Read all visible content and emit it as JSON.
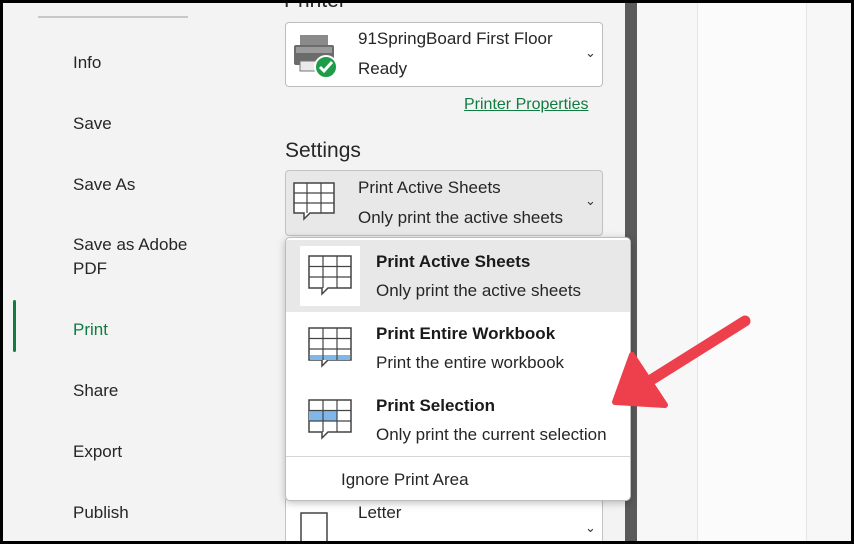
{
  "nav": {
    "items": [
      {
        "label": "Info"
      },
      {
        "label": "Save"
      },
      {
        "label": "Save As"
      },
      {
        "label": "Save as Adobe PDF"
      },
      {
        "label": "Print"
      },
      {
        "label": "Share"
      },
      {
        "label": "Export"
      },
      {
        "label": "Publish"
      }
    ],
    "active": "Print"
  },
  "printer": {
    "heading": "Printer",
    "name": "91SpringBoard First Floor",
    "status": "Ready",
    "properties_link": "Printer Properties"
  },
  "settings": {
    "heading": "Settings",
    "selected_title": "Print Active Sheets",
    "selected_sub": "Only print the active sheets",
    "paper": "Letter"
  },
  "menu": {
    "items": [
      {
        "title": "Print Active Sheets",
        "sub": "Only print the active sheets",
        "icon": "sheet-icon"
      },
      {
        "title": "Print Entire Workbook",
        "sub": "Print the entire workbook",
        "icon": "workbook-icon"
      },
      {
        "title": "Print Selection",
        "sub": "Only print the current selection",
        "icon": "selection-icon"
      }
    ],
    "ignore_print_area": "Ignore Print Area"
  },
  "colors": {
    "accent": "#107c41",
    "annotation_arrow": "#ee3f4c",
    "selection_fill": "#7fb8e8"
  }
}
